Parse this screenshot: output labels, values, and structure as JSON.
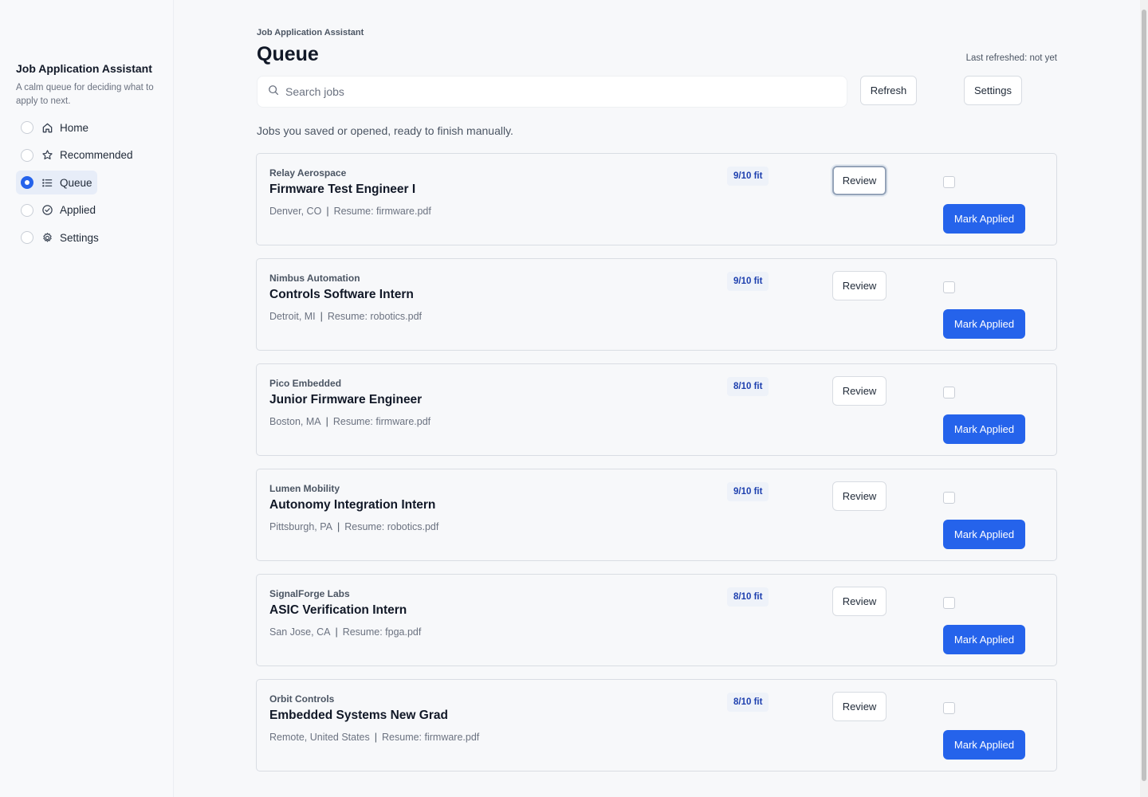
{
  "sidebar": {
    "title": "Job Application Assistant",
    "subtitle": "A calm queue for deciding what to apply to next.",
    "items": [
      {
        "label": "Home",
        "icon": "home-icon",
        "active": false
      },
      {
        "label": "Recommended",
        "icon": "star-icon",
        "active": false
      },
      {
        "label": "Queue",
        "icon": "list-icon",
        "active": true
      },
      {
        "label": "Applied",
        "icon": "check-circle-icon",
        "active": false
      },
      {
        "label": "Settings",
        "icon": "gear-icon",
        "active": false
      }
    ]
  },
  "header": {
    "breadcrumb": "Job Application Assistant",
    "title": "Queue",
    "last_refreshed": "Last refreshed: not yet"
  },
  "search": {
    "placeholder": "Search jobs",
    "value": ""
  },
  "toolbar": {
    "refresh_label": "Refresh",
    "settings_label": "Settings"
  },
  "intro": "Jobs you saved or opened, ready to finish manually.",
  "jobs": [
    {
      "company": "Relay Aerospace",
      "title": "Firmware Test Engineer I",
      "location": "Denver, CO",
      "resume": "Resume: firmware.pdf",
      "fit": "9/10 fit",
      "review_label": "Review",
      "mark_label": "Mark Applied",
      "checked": false
    },
    {
      "company": "Nimbus Automation",
      "title": "Controls Software Intern",
      "location": "Detroit, MI",
      "resume": "Resume: robotics.pdf",
      "fit": "9/10 fit",
      "review_label": "Review",
      "mark_label": "Mark Applied",
      "checked": false
    },
    {
      "company": "Pico Embedded",
      "title": "Junior Firmware Engineer",
      "location": "Boston, MA",
      "resume": "Resume: firmware.pdf",
      "fit": "8/10 fit",
      "review_label": "Review",
      "mark_label": "Mark Applied",
      "checked": false
    },
    {
      "company": "Lumen Mobility",
      "title": "Autonomy Integration Intern",
      "location": "Pittsburgh, PA",
      "resume": "Resume: robotics.pdf",
      "fit": "9/10 fit",
      "review_label": "Review",
      "mark_label": "Mark Applied",
      "checked": false
    },
    {
      "company": "SignalForge Labs",
      "title": "ASIC Verification Intern",
      "location": "San Jose, CA",
      "resume": "Resume: fpga.pdf",
      "fit": "8/10 fit",
      "review_label": "Review",
      "mark_label": "Mark Applied",
      "checked": false
    },
    {
      "company": "Orbit Controls",
      "title": "Embedded Systems New Grad",
      "location": "Remote, United States",
      "resume": "Resume: firmware.pdf",
      "fit": "8/10 fit",
      "review_label": "Review",
      "mark_label": "Mark Applied",
      "checked": false
    }
  ],
  "colors": {
    "accent": "#2563eb",
    "fit_badge_bg": "#eef2f9",
    "fit_badge_text": "#1e40af"
  }
}
